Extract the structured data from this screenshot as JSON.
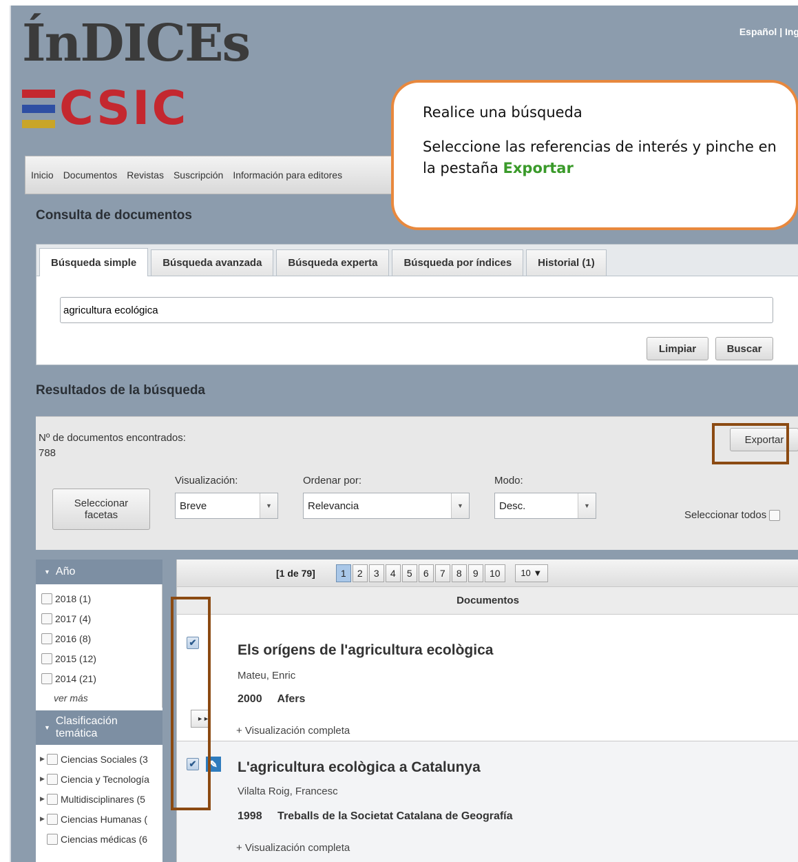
{
  "brand": {
    "name_top": "ÍnDICEs",
    "name_bottom": "CSIC"
  },
  "lang": {
    "text": "Español | Ing"
  },
  "nav": {
    "items": [
      "Inicio",
      "Documentos",
      "Revistas",
      "Suscripción",
      "Información para editores"
    ]
  },
  "callout": {
    "line1": "Realice una búsqueda",
    "line2a": "Seleccione  las referencias de interés y pinche en la pestaña ",
    "line2b": "Exportar",
    "accent": "#3a9a2a",
    "border": "#e8883d"
  },
  "search": {
    "section_title": "Consulta de documentos",
    "tabs": [
      "Búsqueda simple",
      "Búsqueda avanzada",
      "Búsqueda experta",
      "Búsqueda por índices",
      "Historial (1)"
    ],
    "active_tab": "Búsqueda simple",
    "query": "agricultura ecológica",
    "clear_label": "Limpiar",
    "search_label": "Buscar"
  },
  "results": {
    "section_title": "Resultados de la búsqueda",
    "count_label": "Nº de documentos encontrados:",
    "count_value": "788",
    "export_label": "Exportar",
    "facets_button_line1": "Seleccionar",
    "facets_button_line2": "facetas",
    "view_label": "Visualización:",
    "view_value": "Breve",
    "sort_label": "Ordenar por:",
    "sort_value": "Relevancia",
    "mode_label": "Modo:",
    "mode_value": "Desc.",
    "select_all_label": "Seleccionar todos"
  },
  "facets": {
    "year_title": "Año",
    "years": [
      {
        "label": "2018 (1)"
      },
      {
        "label": "2017 (4)"
      },
      {
        "label": "2016 (8)"
      },
      {
        "label": "2015 (12)"
      },
      {
        "label": "2014 (21)"
      }
    ],
    "more_label": "ver más",
    "class_title_line1": "Clasificación",
    "class_title_line2": "temática",
    "classes": [
      {
        "label": "Ciencias Sociales (3"
      },
      {
        "label": "Ciencia y Tecnología"
      },
      {
        "label": "Multidisciplinares (5"
      },
      {
        "label": "Ciencias Humanas ("
      },
      {
        "label": "Ciencias médicas (6"
      }
    ]
  },
  "pager": {
    "count": "[1 de 79]",
    "pages": [
      "1",
      "2",
      "3",
      "4",
      "5",
      "6",
      "7",
      "8",
      "9",
      "10"
    ],
    "current": "1",
    "first_icon": "◄◄",
    "prev_icon": "◄◄",
    "next_icon": "►►",
    "last_icon": "►►",
    "per_page": "10 ▼"
  },
  "docs": {
    "header": "Documentos",
    "items": [
      {
        "title": "Els orígens de l'agricultura ecològica",
        "author": "Mateu, Enric",
        "year": "2000",
        "source": "Afers",
        "more": "+ Visualización completa"
      },
      {
        "title": "L'agricultura ecològica a Catalunya",
        "author": "Vilalta Roig, Francesc",
        "year": "1998",
        "source": "Treballs de la Societat Catalana de Geografía",
        "more": "+ Visualización completa"
      }
    ]
  },
  "colors": {
    "background": "#8c9cad",
    "highlight": "#8b4a12",
    "logo_red": "#c4282f",
    "logo_blue": "#2e4fa3",
    "logo_yellow": "#c9a528"
  }
}
